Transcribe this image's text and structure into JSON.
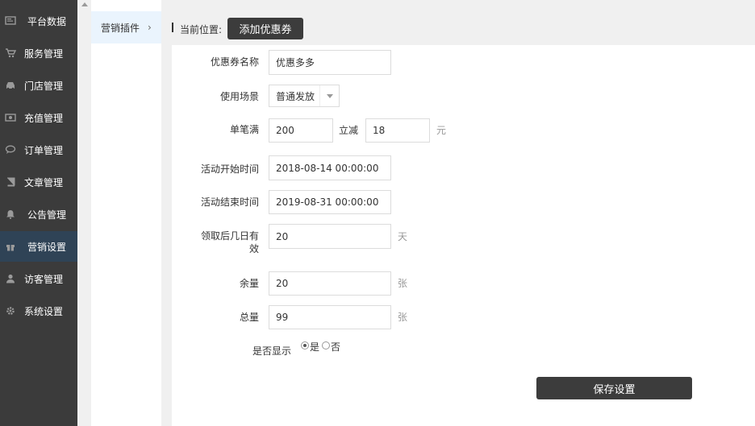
{
  "sidebar": {
    "items": [
      {
        "label": "平台数据",
        "icon": "monitor-icon"
      },
      {
        "label": "服务管理",
        "icon": "cart-icon"
      },
      {
        "label": "门店管理",
        "icon": "car-icon"
      },
      {
        "label": "充值管理",
        "icon": "money-icon"
      },
      {
        "label": "订单管理",
        "icon": "chat-icon"
      },
      {
        "label": "文章管理",
        "icon": "book-icon"
      },
      {
        "label": "公告管理",
        "icon": "bell-icon"
      },
      {
        "label": "营销设置",
        "icon": "gift-icon",
        "active": true
      },
      {
        "label": "访客管理",
        "icon": "user-icon"
      },
      {
        "label": "系统设置",
        "icon": "gear-icon"
      }
    ]
  },
  "subnav": {
    "label": "营销插件",
    "arrow": "›"
  },
  "breadcrumb": {
    "label": "当前位置:",
    "button": "添加优惠券"
  },
  "form": {
    "name": {
      "label": "优惠券名称",
      "value": "优惠多多"
    },
    "scene": {
      "label": "使用场景",
      "value": "普通发放"
    },
    "threshold": {
      "label": "单笔满",
      "value": "200",
      "mid": "立减",
      "discount": "18",
      "unit": "元"
    },
    "start": {
      "label": "活动开始时间",
      "value": "2018-08-14 00:00:00"
    },
    "end": {
      "label": "活动结束时间",
      "value": "2019-08-31 00:00:00"
    },
    "valid": {
      "label_line1": "领取后几日有",
      "label_line2": "效",
      "value": "20",
      "unit": "天"
    },
    "remain": {
      "label": "余量",
      "value": "20",
      "unit": "张"
    },
    "total": {
      "label": "总量",
      "value": "99",
      "unit": "张"
    },
    "show": {
      "label": "是否显示",
      "yes": "是",
      "no": "否",
      "selected": "是"
    }
  },
  "save_button": "保存设置"
}
